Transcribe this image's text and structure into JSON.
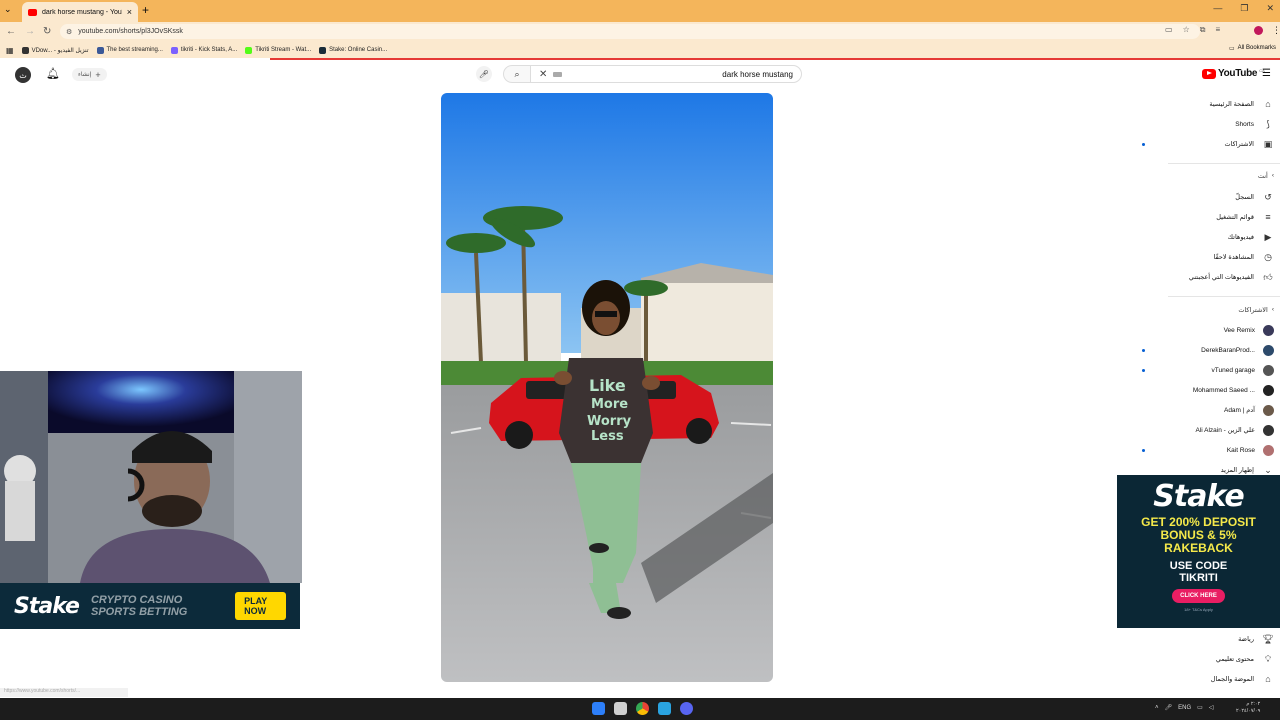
{
  "browser": {
    "tab_title": "dark horse mustang - YouT",
    "url": "youtube.com/shorts/pl3JOvSKssk",
    "bookmarks": [
      {
        "label": "VDow... - تنزيل الفيديو",
        "color": "#333333"
      },
      {
        "label": "The best streaming...",
        "color": "#3b5998"
      },
      {
        "label": "tikriti - Kick Stats, A...",
        "color": "#7b61ff"
      },
      {
        "label": "Tikriti Stream - Wat...",
        "color": "#53fc18"
      },
      {
        "label": "Stake: Online Casin...",
        "color": "#1a2c38"
      }
    ],
    "all_bookmarks": "All Bookmarks"
  },
  "masthead": {
    "avatar_letter": "ث",
    "create_label": "إنشاء",
    "search_value": "dark horse mustang",
    "logo_text": "YouTube",
    "logo_cc": "CA"
  },
  "sidebar": {
    "main": [
      {
        "label": "الصفحة الرئيسية",
        "icon": "home-icon"
      },
      {
        "label": "Shorts",
        "icon": "shorts-icon"
      },
      {
        "label": "الاشتراكات",
        "icon": "subscriptions-icon",
        "dot": true
      }
    ],
    "you_header": "أنت",
    "you": [
      {
        "label": "السجلّ",
        "icon": "history-icon"
      },
      {
        "label": "قوائم التشغيل",
        "icon": "playlists-icon"
      },
      {
        "label": "فيديوهاتك",
        "icon": "your-videos-icon"
      },
      {
        "label": "المشاهدة لاحقًا",
        "icon": "watch-later-icon"
      },
      {
        "label": "الفيديوهات التي أعجبتني",
        "icon": "liked-icon"
      }
    ],
    "subs_header": "الاشتراكات",
    "subs": [
      {
        "label": "Vee Remix",
        "color": "#3a3a5a",
        "dot": false
      },
      {
        "label": "DerekBaranProd...",
        "color": "#2d4a6b",
        "dot": true
      },
      {
        "label": "vTuned garage",
        "color": "#555555",
        "dot": true
      },
      {
        "label": "Mohammed Saeed ...",
        "color": "#222222",
        "dot": false
      },
      {
        "label": "Adam | آدم",
        "color": "#6b5a4a",
        "dot": false
      },
      {
        "label": "Ali Alzain - علي الزين",
        "color": "#333333",
        "dot": false
      },
      {
        "label": "Kait Rose",
        "color": "#b07070",
        "dot": true
      }
    ],
    "show_more": "إظهار المزيد",
    "explore": [
      {
        "label": "رياضة",
        "icon": "trophy-icon"
      },
      {
        "label": "محتوى تعليمي",
        "icon": "lightbulb-icon"
      },
      {
        "label": "الموضة والجمال",
        "icon": "hanger-icon"
      }
    ]
  },
  "webcam": {
    "banner_logo": "Stake",
    "banner_tag": "CRYPTO CASINO  SPORTS BETTING",
    "banner_button": "PLAY NOW"
  },
  "ad": {
    "logo": "Stake",
    "promo_line1": "GET 200% DEPOSIT",
    "promo_line2": "BONUS & 5%",
    "promo_line3": "RAKEBACK",
    "code_line1": "USE CODE",
    "code_line2": "TIKRITI",
    "button": "CLICK HERE",
    "fine": "18+ T&Cs Apply"
  },
  "status_url": "https://www.youtube.com/shorts/...",
  "taskbar": {
    "lang": "ENG",
    "time": "٢:٠٢ م",
    "date": "٢٠٢٤/٠٧/٠٩"
  }
}
